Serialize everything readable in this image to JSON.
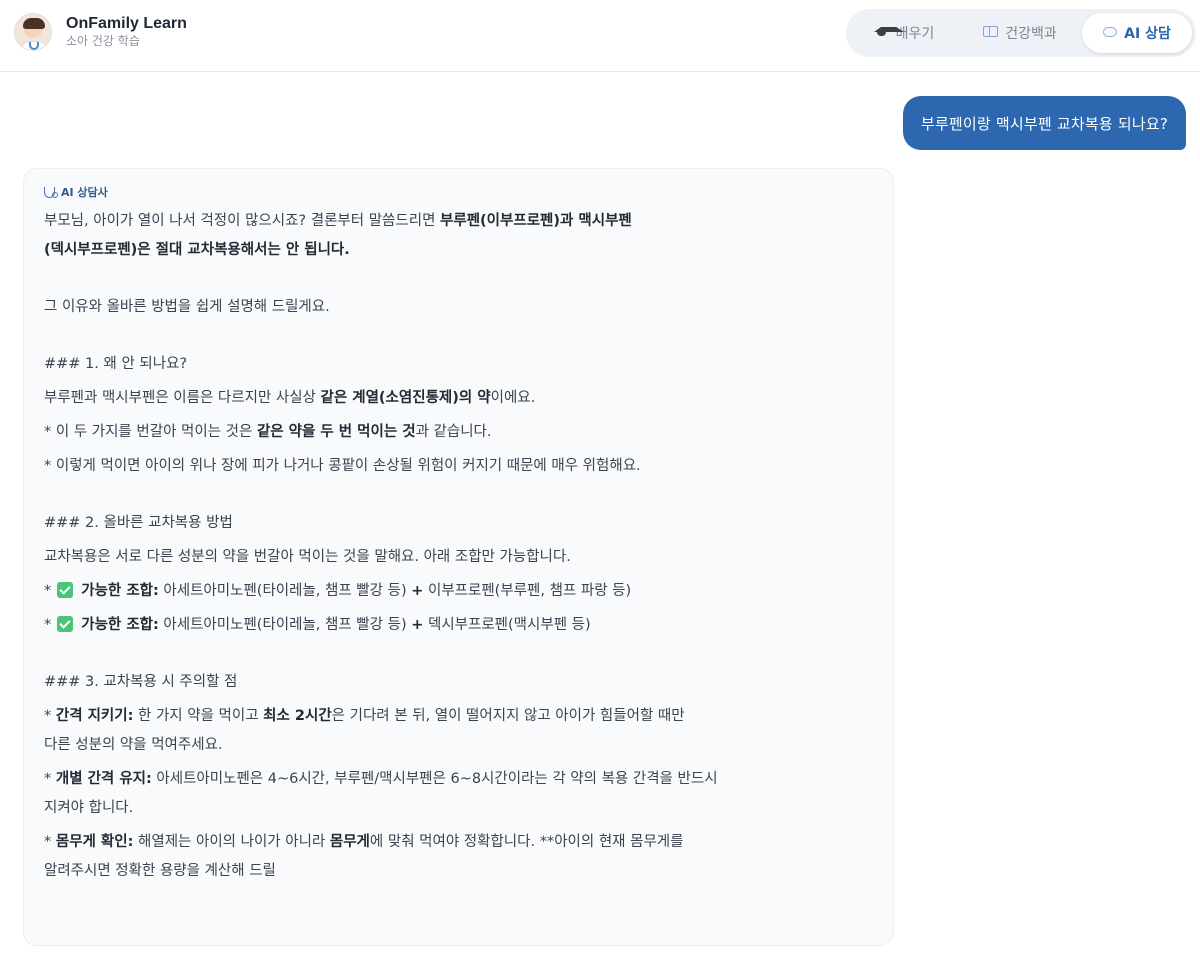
{
  "header": {
    "title": "OnFamily Learn",
    "subtitle": "소아 건강 학습"
  },
  "nav": {
    "tabs": [
      {
        "label": "배우기",
        "icon": "graduation-cap-icon"
      },
      {
        "label": "건강백과",
        "icon": "book-icon"
      },
      {
        "label": "AI 상담",
        "icon": "speech-bubble-icon",
        "active": true
      }
    ]
  },
  "chat": {
    "user_message": "부루펜이랑 맥시부펜 교차복용 되나요?",
    "ai_label": "AI 상담사",
    "p1": {
      "t1": "부모님, 아이가 열이 나서 걱정이 많으시죠? 결론부터 말씀드리면 ",
      "b1": "부루펜(이부프로펜)과 맥시부펜",
      "b2": "(덱시부프로펜)은 절대 교차복용해서는 안 됩니다."
    },
    "p2": "그 이유와 올바른 방법을 쉽게 설명해 드릴게요.",
    "s1": {
      "heading": "### 1. 왜 안 되나요?",
      "l1_a": "부루펜과 맥시부펜은 이름은 다르지만 사실상 ",
      "l1_b": "같은 계열(소염진통제)의 약",
      "l1_c": "이에요.",
      "l2_a": "* 이 두 가지를 번갈아 먹이는 것은 ",
      "l2_b": "같은 약을 두 번 먹이는 것",
      "l2_c": "과 같습니다.",
      "l3": "* 이렇게 먹이면 아이의 위나 장에 피가 나거나 콩팥이 손상될 위험이 커지기 때문에 매우 위험해요."
    },
    "s2": {
      "heading": "### 2. 올바른 교차복용 방법",
      "intro": "교차복용은 서로 다른 성분의 약을 번갈아 먹이는 것을 말해요. 아래 조합만 가능합니다.",
      "c1": {
        "star": "*",
        "label": "가능한 조합:",
        "a": " 아세트아미노펜(타이레놀, 챔프 빨강 등) ",
        "plus": "+",
        "b": " 이부프로펜(부루펜, 챔프 파랑 등)"
      },
      "c2": {
        "star": "*",
        "label": "가능한 조합:",
        "a": " 아세트아미노펜(타이레놀, 챔프 빨강 등) ",
        "plus": "+",
        "b": " 덱시부프로펜(맥시부펜 등)"
      }
    },
    "s3": {
      "heading": "### 3. 교차복용 시 주의할 점",
      "i1": {
        "star": "* ",
        "label": "간격 지키기:",
        "a": " 한 가지 약을 먹이고 ",
        "b": "최소 2시간",
        "c": "은 기다려 본 뒤, 열이 떨어지지 않고 아이가 힘들어할 때만",
        "d": "다른 성분의 약을 먹여주세요."
      },
      "i2": {
        "star": "* ",
        "label": "개별 간격 유지:",
        "a": " 아세트아미노펜은 4~6시간, 부루펜/맥시부펜은 6~8시간이라는 각 약의 복용 간격을 반드시",
        "b": "지켜야 합니다."
      },
      "i3": {
        "star": "* ",
        "label": "몸무게 확인:",
        "a": " 해열제는 아이의 나이가 아니라 ",
        "b": "몸무게",
        "c": "에 맞춰 먹여야 정확합니다. **아이의 현재 몸무게를",
        "d": "알려주시면 정확한 용량을 계산해 드릴"
      }
    }
  },
  "colors": {
    "accent": "#2c67b0",
    "card_bg": "#f8fafc",
    "check_green": "#4cc37a"
  }
}
